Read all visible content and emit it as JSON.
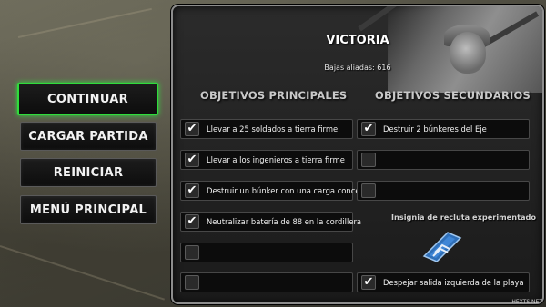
{
  "menu": {
    "continue": "CONTINUAR",
    "load": "CARGAR PARTIDA",
    "restart": "REINICIAR",
    "main_menu": "MENÚ PRINCIPAL"
  },
  "panel": {
    "title": "VICTORIA",
    "casualties": "Bajas aliadas: 616",
    "primary_header": "OBJETIVOS PRINCIPALES",
    "secondary_header": "OBJETIVOS SECUNDARIOS",
    "badge_title": "Insignia de recluta experimentado"
  },
  "primary_objectives": [
    {
      "text": "Llevar a 25 soldados a tierra firme",
      "checked": true
    },
    {
      "text": "Llevar a los ingenieros a tierra firme",
      "checked": true
    },
    {
      "text": "Destruir un búnker con una carga concentrada",
      "checked": true
    },
    {
      "text": "Neutralizar batería de 88 en la cordillera",
      "checked": true
    },
    {
      "text": "",
      "checked": false
    },
    {
      "text": "",
      "checked": false
    }
  ],
  "secondary_objectives": [
    {
      "text": "Destruir 2 búnkeres del Eje",
      "checked": true
    },
    {
      "text": "",
      "checked": false
    },
    {
      "text": "",
      "checked": false
    },
    {
      "text": "Despejar salida izquierda de la playa",
      "checked": true
    }
  ],
  "icons": {
    "check": "check-icon",
    "badge": "recruit-badge-icon"
  },
  "colors": {
    "highlight": "#2fdc3c"
  },
  "watermark": "HEXTS.NET"
}
